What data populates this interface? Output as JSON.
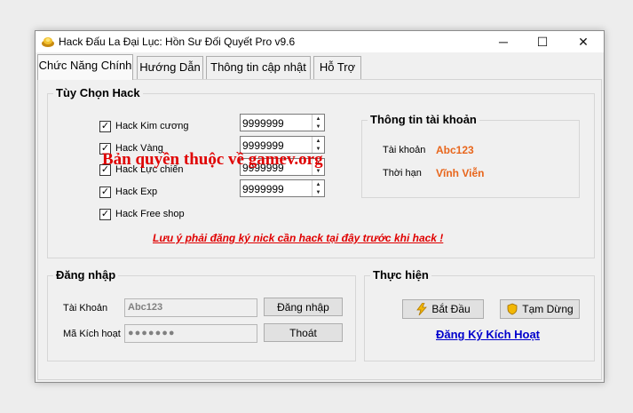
{
  "window": {
    "title": "Hack Đấu La Đại Lục: Hồn Sư Đối Quyết Pro v9.6",
    "minimize_glyph": "─",
    "maximize_glyph": "☐",
    "close_glyph": "✕"
  },
  "tabs": [
    {
      "label": "Chức Năng Chính"
    },
    {
      "label": "Hướng Dẫn"
    },
    {
      "label": "Thông tin cập nhật"
    },
    {
      "label": "Hỗ Trợ"
    }
  ],
  "hack_options": {
    "title": "Tùy Chọn Hack",
    "items": [
      {
        "label": "Hack Kim cương",
        "checked": "✓",
        "value": "9999999"
      },
      {
        "label": "Hack Vàng",
        "checked": "✓",
        "value": "9999999"
      },
      {
        "label": "Hack Lực chiến",
        "checked": "✓",
        "value": "9999999"
      },
      {
        "label": "Hack Exp",
        "checked": "✓",
        "value": "9999999"
      },
      {
        "label": "Hack Free shop",
        "checked": "✓"
      }
    ],
    "warning": "Lưu ý phải đăng ký nick cần hack tại đây trước khi hack !"
  },
  "watermark": "Bản quyền thuộc về gamev.org",
  "account_info": {
    "title": "Thông tin tài khoản",
    "account_label": "Tài khoản",
    "account_value": "Abc123",
    "expiry_label": "Thời hạn",
    "expiry_value": "Vĩnh Viễn"
  },
  "login": {
    "title": "Đăng nhập",
    "account_label": "Tài Khoản",
    "account_value": "Abc123",
    "key_label": "Mã Kích hoạt",
    "key_value": "●●●●●●●",
    "login_button": "Đăng nhập",
    "logout_button": "Thoát"
  },
  "actions": {
    "title": "Thực hiện",
    "start_button": "Bắt Đầu",
    "pause_button": "Tạm Dừng",
    "register_link": "Đăng Ký Kích Hoạt"
  },
  "colors": {
    "accent_orange": "#e8661c",
    "warning_red": "#e00000",
    "link_blue": "#0000cc"
  }
}
